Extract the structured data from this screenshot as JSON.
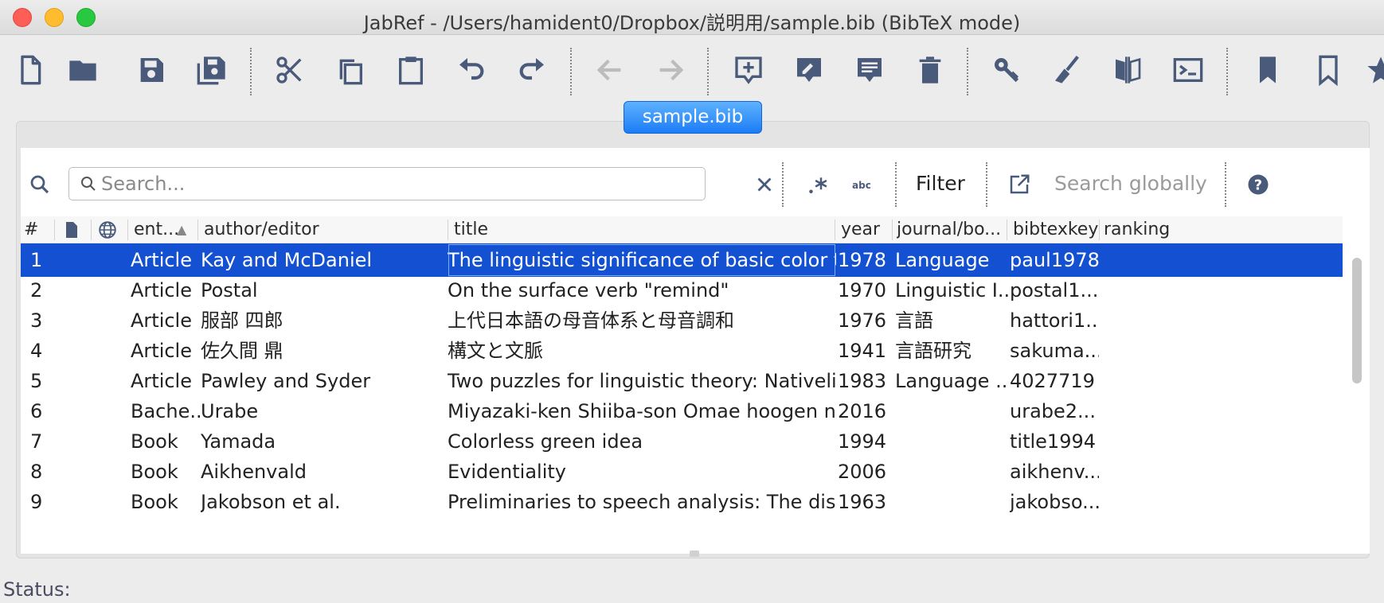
{
  "window": {
    "title": "JabRef - /Users/hamident0/Dropbox/説明用/sample.bib (BibTeX mode)"
  },
  "toolbar": {
    "icons": [
      "new-file-icon",
      "open-folder-icon",
      "save-icon",
      "save-all-icon",
      "cut-icon",
      "copy-icon",
      "paste-icon",
      "undo-icon",
      "redo-icon",
      "back-icon",
      "forward-icon",
      "new-entry-icon",
      "edit-entry-icon",
      "comment-icon",
      "delete-icon",
      "key-icon",
      "cleanup-icon",
      "merge-icon",
      "terminal-icon",
      "bookmark-filled-icon",
      "bookmark-outline-icon",
      "star-icon"
    ]
  },
  "tab": {
    "label": "sample.bib"
  },
  "search": {
    "placeholder": "Search...",
    "filter_label": "Filter",
    "global_label": "Search globally"
  },
  "table": {
    "headers": {
      "num": "#",
      "entrytype": "ent...",
      "author": "author/editor",
      "title": "title",
      "year": "year",
      "journal": "journal/bo...",
      "bibtexkey": "bibtexkey",
      "ranking": "ranking"
    },
    "rows": [
      {
        "num": "1",
        "type": "Article",
        "author": "Kay and McDaniel",
        "title": "The linguistic significance of basic color terms",
        "year": "1978",
        "journal": "Language",
        "key": "paul1978",
        "selected": true
      },
      {
        "num": "2",
        "type": "Article",
        "author": "Postal",
        "title": "On the surface verb \"remind\"",
        "year": "1970",
        "journal": "Linguistic I...",
        "key": "postal1..."
      },
      {
        "num": "3",
        "type": "Article",
        "author": "服部 四郎",
        "title": "上代日本語の母音体系と母音調和",
        "year": "1976",
        "journal": "言語",
        "key": "hattori1..."
      },
      {
        "num": "4",
        "type": "Article",
        "author": "佐久間 鼎",
        "title": "構文と文脈",
        "year": "1941",
        "journal": "言語研究",
        "key": "sakuma..."
      },
      {
        "num": "5",
        "type": "Article",
        "author": "Pawley and Syder",
        "title": "Two puzzles for linguistic theory: Nativelike ...",
        "year": "1983",
        "journal": "Language ...",
        "key": "4027719"
      },
      {
        "num": "6",
        "type": "Bache...",
        "author": "Urabe",
        "title": "Miyazaki-ken Shiiba-son Omae hoogen ni o...",
        "year": "2016",
        "journal": "",
        "key": "urabe2..."
      },
      {
        "num": "7",
        "type": "Book",
        "author": "Yamada",
        "title": "Colorless green idea",
        "year": "1994",
        "journal": "",
        "key": "title1994"
      },
      {
        "num": "8",
        "type": "Book",
        "author": "Aikhenvald",
        "title": "Evidentiality",
        "year": "2006",
        "journal": "",
        "key": "aikhenv..."
      },
      {
        "num": "9",
        "type": "Book",
        "author": "Jakobson et al.",
        "title": "Preliminaries to speech analysis: The distinc...",
        "year": "1963",
        "journal": "",
        "key": "jakobso..."
      }
    ]
  },
  "status": {
    "label": "Status:"
  },
  "colors": {
    "icon": "#4a5a7a",
    "selection": "#1350d2",
    "tab": "#1b7cf5"
  }
}
